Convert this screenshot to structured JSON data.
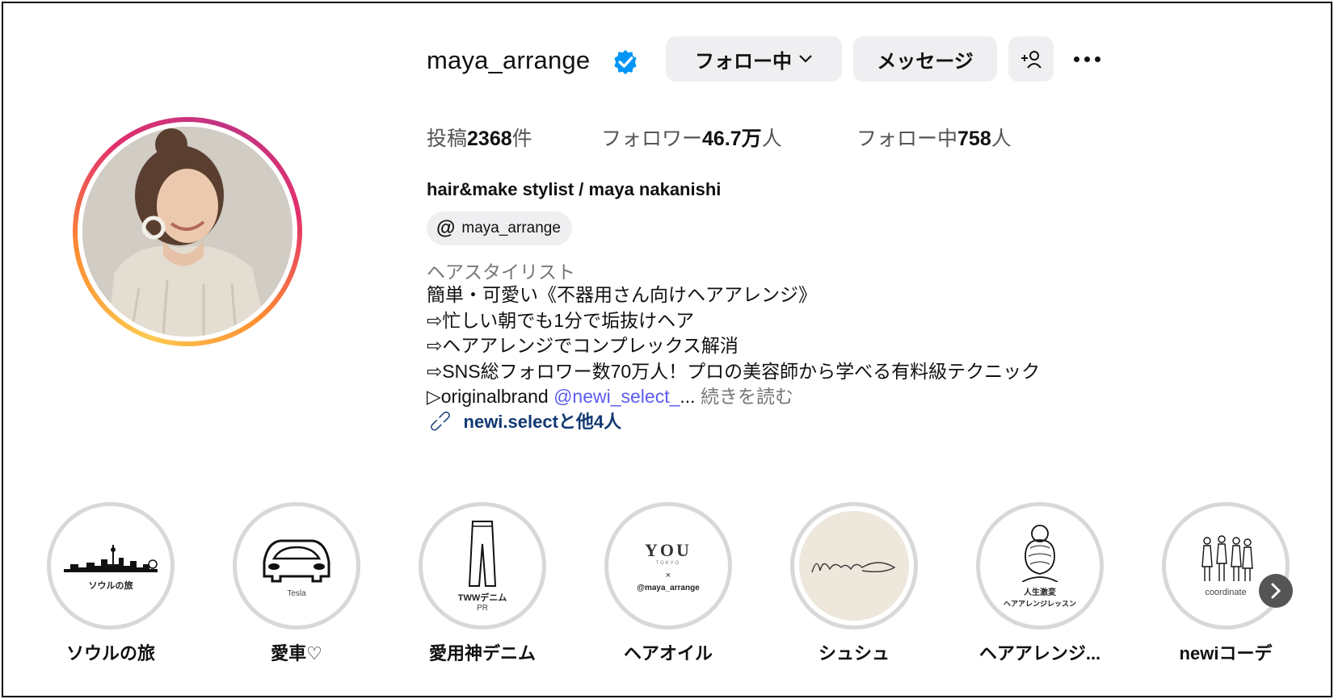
{
  "profile": {
    "username": "maya_arrange",
    "verified_icon": "verified-badge-icon",
    "stats": {
      "posts_label": "投稿",
      "posts_value": "2368",
      "posts_unit": "件",
      "followers_label": "フォロワー",
      "followers_value": "46.7万",
      "followers_unit": "人",
      "following_label": "フォロー中",
      "following_value": "758",
      "following_unit": "人"
    },
    "full_name": "hair&make stylist / maya nakanishi",
    "threads_handle": "maya_arrange",
    "category": "ヘアスタイリスト",
    "bio_lines": [
      "簡単・可愛い《不器用さん向けヘアアレンジ》",
      "⇨忙しい朝でも1分で垢抜けヘア",
      "⇨ヘアアレンジでコンプレックス解消",
      "⇨SNS総フォロワー数70万人！プロの美容師から学べる有料級テクニック"
    ],
    "bio_last_prefix": "▷originalbrand ",
    "bio_mention": "@newi_select_",
    "bio_ellipsis": "...",
    "bio_more": "続きを読む",
    "link_text": "newi.selectと他4人"
  },
  "actions": {
    "follow_label": "フォロー中",
    "message_label": "メッセージ",
    "add_user_label": "+",
    "chevron": "⌄"
  },
  "highlights": [
    {
      "title": "ソウルの旅",
      "caption": "ソウルの旅",
      "icon": "seoul-skyline-icon"
    },
    {
      "title": "愛車♡",
      "caption": "Tesla",
      "icon": "car-icon"
    },
    {
      "title": "愛用神デニム",
      "caption": "TWWデニム",
      "caption2": "PR",
      "icon": "jeans-icon"
    },
    {
      "title": "ヘアオイル",
      "caption": "@maya_arrange",
      "brand": "YOU",
      "brand_sub": "TOKYO",
      "cross": "×",
      "icon": "you-logo-icon"
    },
    {
      "title": "シュシュ",
      "caption": "",
      "icon": "newi-signature-icon"
    },
    {
      "title": "ヘアアレンジ...",
      "caption": "人生激変",
      "caption2": "ヘアアレンジレッスン",
      "icon": "hair-bun-illustration-icon"
    },
    {
      "title": "newiコーデ",
      "caption": "coordinate",
      "icon": "coordinate-illustration-icon"
    }
  ],
  "colors": {
    "button_bg": "#efeff1",
    "verified_blue": "#0095f6",
    "mention": "#5c5cf0",
    "link": "#123a73"
  }
}
